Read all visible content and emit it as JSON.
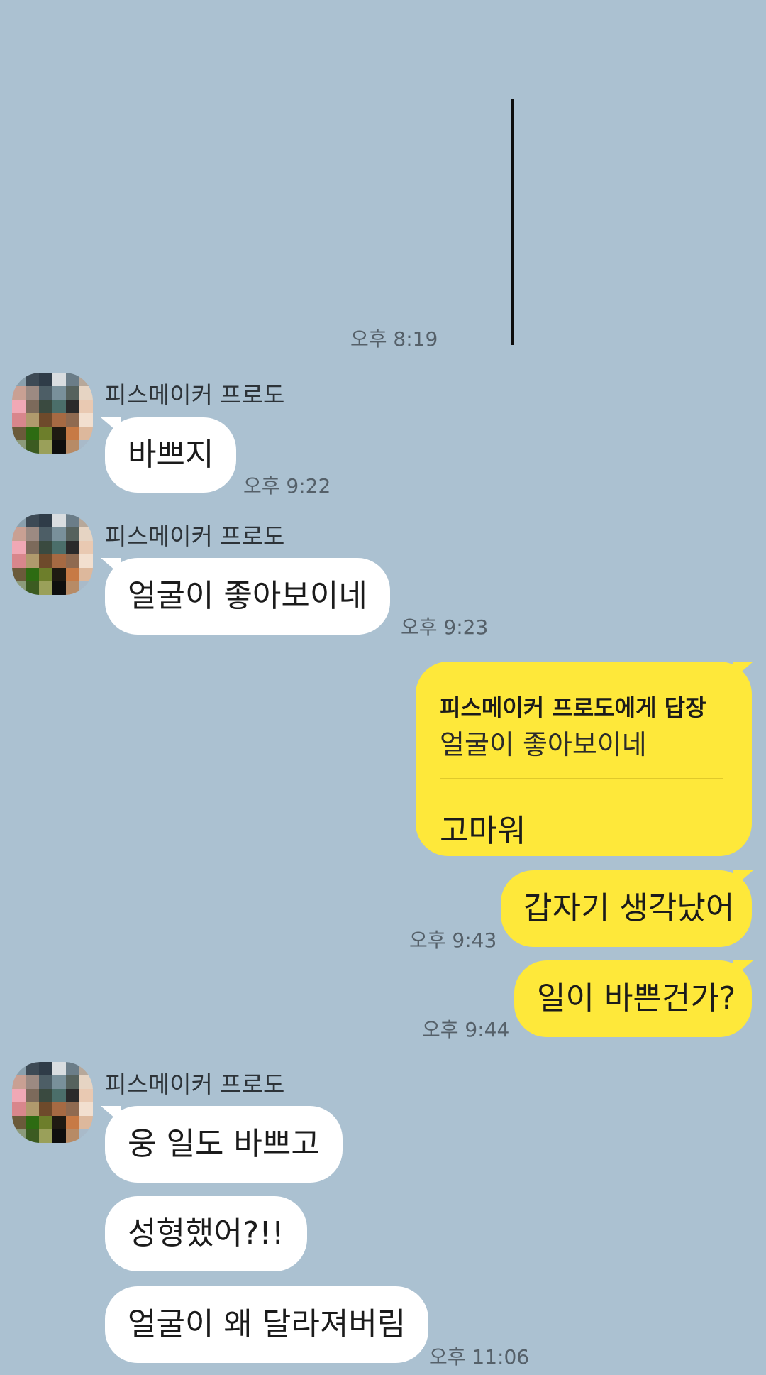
{
  "top_time": "오후 8:19",
  "avatar_colors": [
    "#8aa0ad",
    "#3d4a55",
    "#2f3c48",
    "#d9dde0",
    "#6b7d88",
    "#b7a89a",
    "#c9a093",
    "#9c8a82",
    "#4d5e66",
    "#79909a",
    "#56625d",
    "#e6d4c3",
    "#f0a8b5",
    "#7c6a5b",
    "#3a4a40",
    "#4b6e6a",
    "#2a2a2a",
    "#e9c9b2",
    "#d8868c",
    "#b09a6d",
    "#6e4a2b",
    "#a66a43",
    "#8f6a50",
    "#f2dfcf",
    "#6a5a3a",
    "#2d6b12",
    "#6d7e2b",
    "#1f1a12",
    "#c77a45",
    "#ddb89c",
    "#8c9a7a",
    "#3c5b21",
    "#9aa05a",
    "#0e0e0e",
    "#b78b66",
    "#a9bac9"
  ],
  "messages": {
    "m1": {
      "sender": "피스메이커 프로도",
      "text": "바쁘지",
      "time": "오후 9:22"
    },
    "m2": {
      "sender": "피스메이커 프로도",
      "text": "얼굴이 좋아보이네",
      "time": "오후 9:23"
    },
    "reply": {
      "header": "피스메이커 프로도에게 답장",
      "quoted": "얼굴이 좋아보이네",
      "text": "고마워"
    },
    "m3": {
      "text": "갑자기 생각났어",
      "time": "오후 9:43"
    },
    "m4": {
      "text": "일이 바쁜건가?",
      "time": "오후 9:44"
    },
    "m5": {
      "sender": "피스메이커 프로도",
      "lines": [
        "웅 일도 바쁘고",
        "성형했어?!!",
        "얼굴이 왜 달라져버림"
      ],
      "time": "오후 11:06"
    }
  }
}
